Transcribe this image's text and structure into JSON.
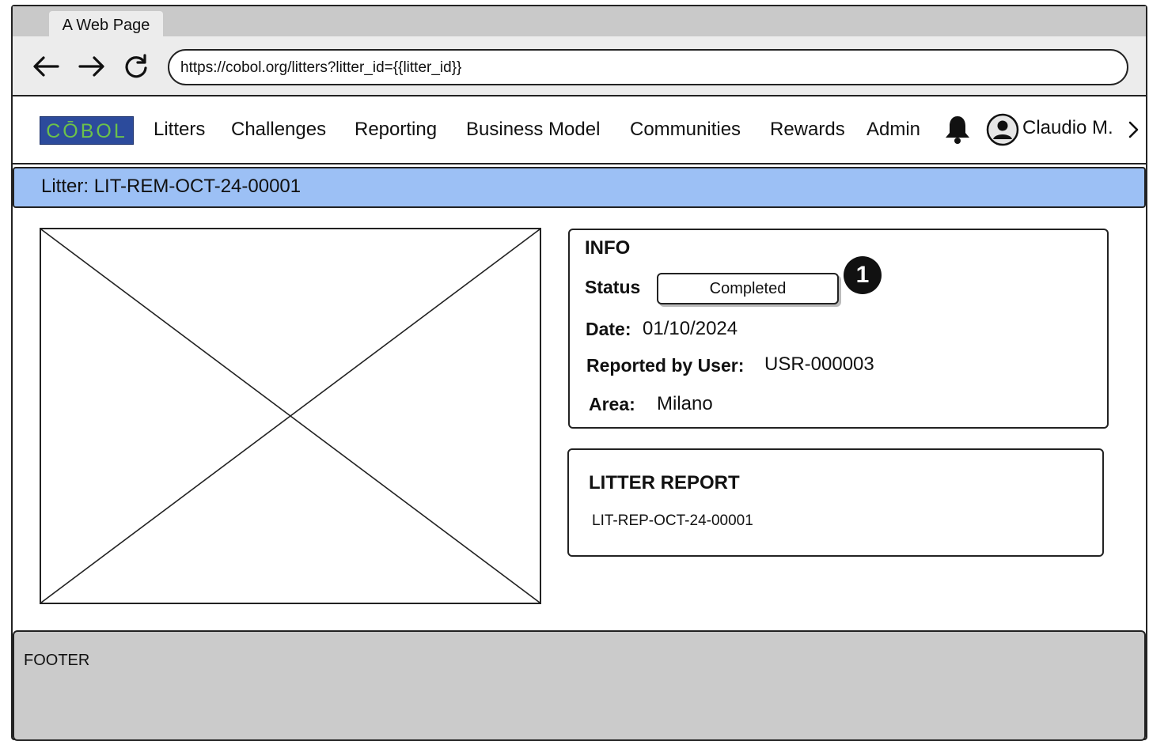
{
  "browser": {
    "tab_title": "A Web Page",
    "url": "https://cobol.org/litters?litter_id={{litter_id}}"
  },
  "navbar": {
    "logo_text": "CŌBOL",
    "links": [
      "Litters",
      "Challenges",
      "Reporting",
      "Business Model",
      "Communities",
      "Rewards",
      "Admin"
    ],
    "user_name": "Claudio M.",
    "icons": [
      "bell-icon",
      "user-avatar-icon",
      "chevron-right-icon"
    ]
  },
  "page": {
    "title": "Litter: LIT-REM-OCT-24-00001"
  },
  "info": {
    "heading": "INFO",
    "status_label": "Status",
    "status_value": "Completed",
    "status_marker": "1",
    "date_label": "Date:",
    "date_value": "01/10/2024",
    "reported_label": "Reported by User:",
    "reported_value": "USR-000003",
    "area_label": "Area:",
    "area_value": "Milano"
  },
  "report": {
    "heading": "LITTER REPORT",
    "report_id": "LIT-REP-OCT-24-00001"
  },
  "footer": {
    "label": "FOOTER"
  },
  "colors": {
    "title_bar": "#9cc0f5",
    "logo_bg": "#2c4b9c",
    "logo_text": "#6cc24a",
    "footer_bg": "#cbcbcb",
    "chrome_bg": "#ececec"
  }
}
